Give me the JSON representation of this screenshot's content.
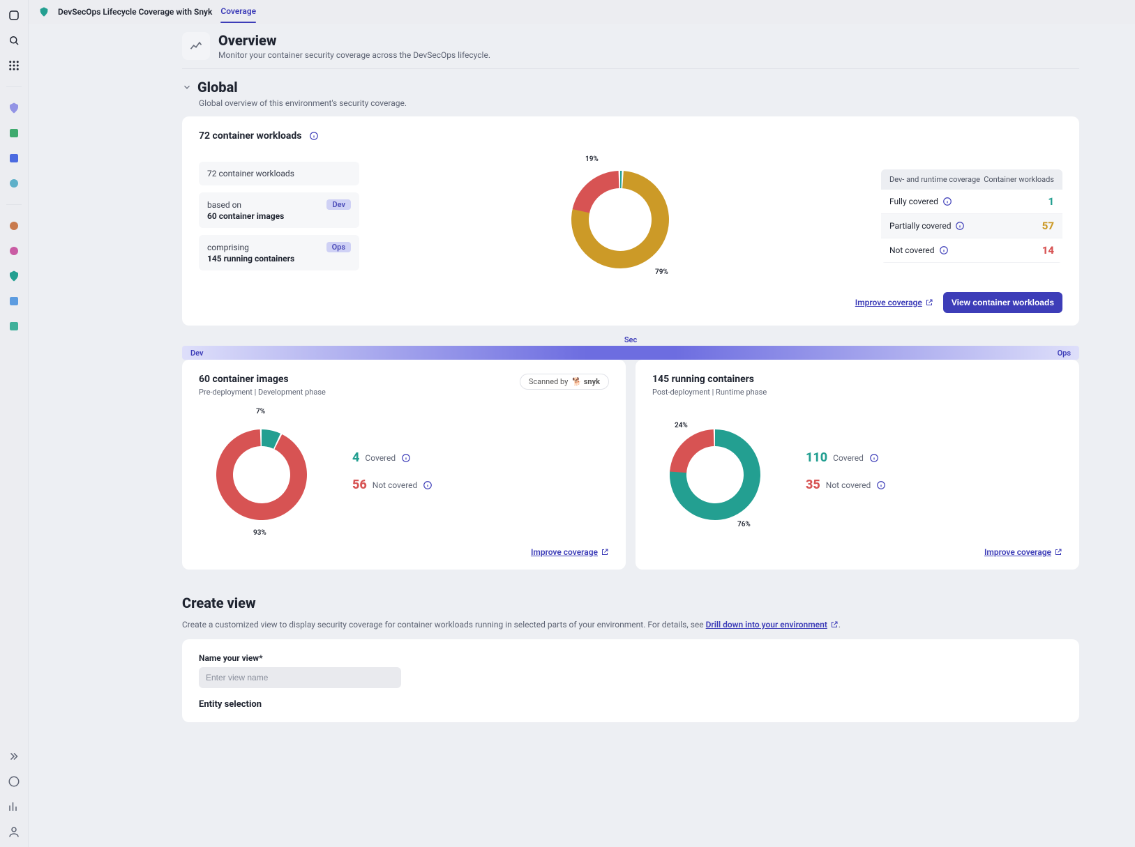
{
  "topbar": {
    "title": "DevSecOps Lifecycle Coverage with Snyk",
    "tab": "Coverage"
  },
  "overview": {
    "title": "Overview",
    "subtitle": "Monitor your container security coverage across the DevSecOps lifecycle."
  },
  "global": {
    "title": "Global",
    "subtitle": "Global overview of this environment's security coverage.",
    "workloads_title": "72 container workloads",
    "sub1": {
      "line1": "72 container workloads"
    },
    "sub2": {
      "line1": "based on",
      "line2": "60 container images",
      "pill": "Dev"
    },
    "sub3": {
      "line1": "comprising",
      "line2": "145 running containers",
      "pill": "Ops"
    },
    "table": {
      "th1": "Dev- and runtime coverage",
      "th2": "Container workloads",
      "r1": {
        "label": "Fully covered",
        "value": "1"
      },
      "r2": {
        "label": "Partially covered",
        "value": "57"
      },
      "r3": {
        "label": "Not covered",
        "value": "14"
      }
    },
    "improve": "Improve coverage",
    "view_btn": "View container workloads"
  },
  "dso": {
    "sec": "Sec",
    "dev": "Dev",
    "ops": "Ops"
  },
  "dev_card": {
    "title": "60 container images",
    "subtitle": "Pre-deployment | Development phase",
    "scanned_by": "Scanned by",
    "snyk": "snyk",
    "covered": {
      "num": "4",
      "label": "Covered"
    },
    "not_covered": {
      "num": "56",
      "label": "Not covered"
    },
    "improve": "Improve coverage"
  },
  "ops_card": {
    "title": "145 running containers",
    "subtitle": "Post-deployment | Runtime phase",
    "covered": {
      "num": "110",
      "label": "Covered"
    },
    "not_covered": {
      "num": "35",
      "label": "Not covered"
    },
    "improve": "Improve coverage"
  },
  "create_view": {
    "title": "Create view",
    "subtitle_a": "Create a customized view to display security coverage for container workloads running in selected parts of your environment. For details, see ",
    "link": "Drill down into your environment",
    "subtitle_b": ".",
    "name_label": "Name your view*",
    "name_placeholder": "Enter view name",
    "entity_title": "Entity selection"
  },
  "chart_data": [
    {
      "type": "pie",
      "id": "workloads-donut",
      "title": "Container workload coverage",
      "categories": [
        "Fully covered",
        "Partially covered",
        "Not covered"
      ],
      "values": [
        1,
        57,
        14
      ],
      "percent_labels": [
        "",
        "79%",
        "19%"
      ],
      "colors": [
        "#239f91",
        "#cc9a27",
        "#d75353"
      ]
    },
    {
      "type": "pie",
      "id": "images-donut",
      "title": "Container images coverage",
      "categories": [
        "Covered",
        "Not covered"
      ],
      "values": [
        4,
        56
      ],
      "percent_labels": [
        "7%",
        "93%"
      ],
      "colors": [
        "#239f91",
        "#d75353"
      ]
    },
    {
      "type": "pie",
      "id": "containers-donut",
      "title": "Running containers coverage",
      "categories": [
        "Covered",
        "Not covered"
      ],
      "values": [
        110,
        35
      ],
      "percent_labels": [
        "76%",
        "24%"
      ],
      "colors": [
        "#239f91",
        "#d75353"
      ]
    }
  ]
}
